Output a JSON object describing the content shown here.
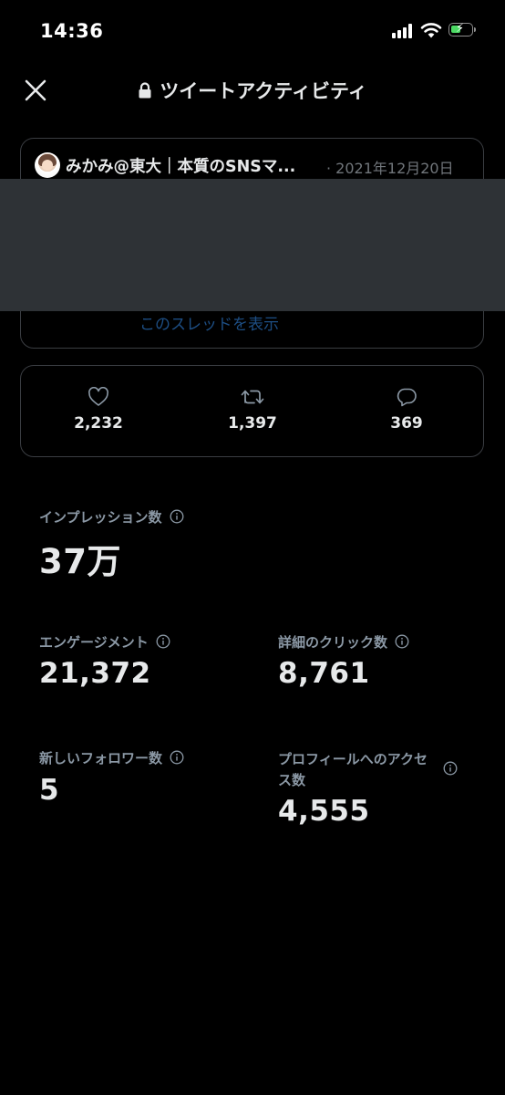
{
  "status_bar": {
    "time": "14:36"
  },
  "header": {
    "title": "ツイートアクティビティ"
  },
  "tweet": {
    "author": "みかみ@東大｜本質のSNSマ...",
    "date": "· 2021年12月20日",
    "thread_link": "このスレッドを表示"
  },
  "engagement": {
    "likes": "2,232",
    "retweets": "1,397",
    "replies": "369"
  },
  "metrics": {
    "impressions": {
      "label": "インプレッション数",
      "value": "37万"
    },
    "engagements": {
      "label": "エンゲージメント",
      "value": "21,372"
    },
    "detail_clicks": {
      "label": "詳細のクリック数",
      "value": "8,761"
    },
    "new_followers": {
      "label": "新しいフォロワー数",
      "value": "5"
    },
    "profile_visits": {
      "label": "プロフィールへのアクセス数",
      "value": "4,555"
    }
  },
  "colors": {
    "background": "#000000",
    "text_primary": "#e7e9ea",
    "text_secondary": "#8b98a5",
    "border": "#3a3d42",
    "redaction": "#2e3236",
    "link": "#1d4e84",
    "battery_fill": "#4cd964"
  },
  "icons": {
    "close": "close-icon",
    "lock": "lock-icon",
    "like": "heart-icon",
    "retweet": "retweet-icon",
    "reply": "reply-icon",
    "info": "info-icon"
  }
}
